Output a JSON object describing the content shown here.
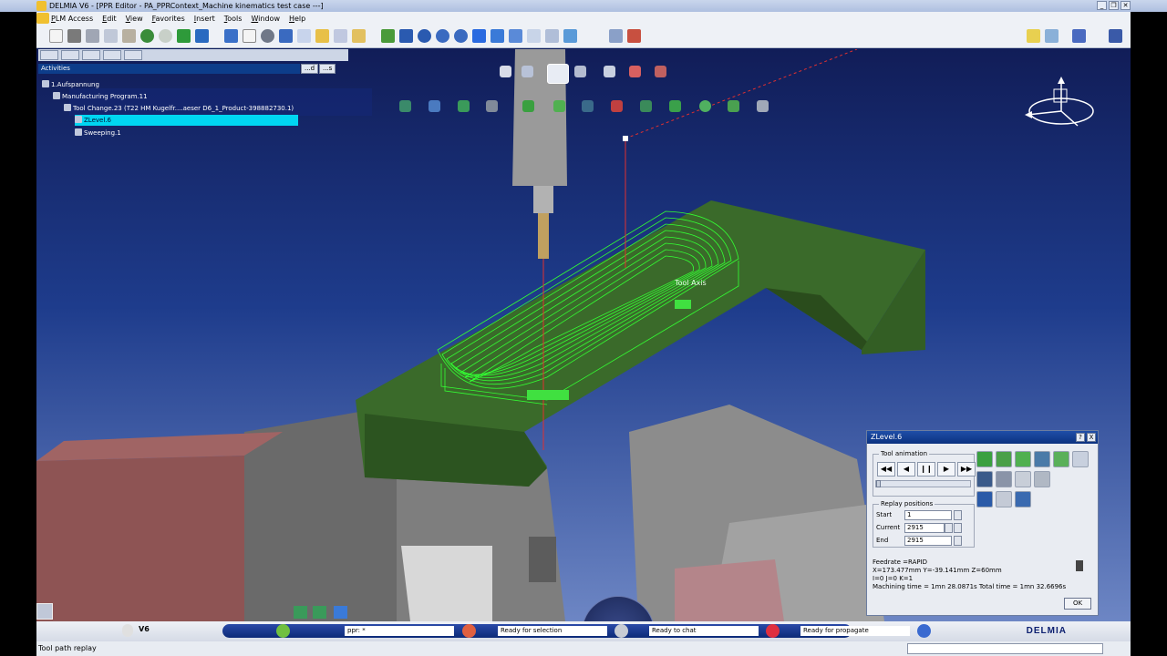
{
  "window": {
    "title": "DELMIA V6 - [PPR Editor - PA_PPRContext_Machine kinematics test case ---]",
    "controls": [
      "_",
      "❐",
      "✕"
    ]
  },
  "menu": [
    "PLM Access",
    "Edit",
    "View",
    "Favorites",
    "Insert",
    "Tools",
    "Window",
    "Help"
  ],
  "tree": {
    "header": "Activities",
    "btn_d": "...d",
    "btn_s": "...s",
    "rows": [
      {
        "label": "1.Aufspannung"
      },
      {
        "label": "Manufacturing Program.11"
      },
      {
        "label": "Tool Change.23 (T22 HM Kugelfr....aeser D6_1_Product-398882730.1)"
      },
      {
        "label": "ZLevel.6"
      },
      {
        "label": "Sweeping.1"
      }
    ]
  },
  "viewport": {
    "tool_axis_label": "Tool Axis",
    "part_color": "#3a6a2a",
    "toolpath_color": "#33ff33"
  },
  "dialog": {
    "title": "ZLevel.6",
    "help": "?",
    "close": "X",
    "tool_animation_label": "Tool animation",
    "replay_positions_label": "Replay positions",
    "start_label": "Start",
    "start_value": "1",
    "current_label": "Current",
    "current_value": "2915",
    "end_label": "End",
    "end_value": "2915",
    "feedrate": "Feedrate =RAPID",
    "coords": "X=173.477mm Y=-39.141mm Z=60mm",
    "ijk": "I=0 J=0 K=1",
    "machining_time": "Machining time = 1mn 28.0871s   Total time = 1mn 32.6696s",
    "ok": "OK",
    "slider_progress": 0.0,
    "play_buttons": [
      "◀◀",
      "◀",
      "❙❙",
      "▶",
      "▶▶"
    ]
  },
  "bottom": {
    "product": "V6",
    "fields": [
      {
        "value": "ppr: *"
      },
      {
        "value": "Ready for selection"
      },
      {
        "value": "Ready to chat"
      },
      {
        "value": "Ready for propagate"
      }
    ],
    "brand": "DELMIA"
  },
  "status": {
    "text": "Tool path replay"
  }
}
